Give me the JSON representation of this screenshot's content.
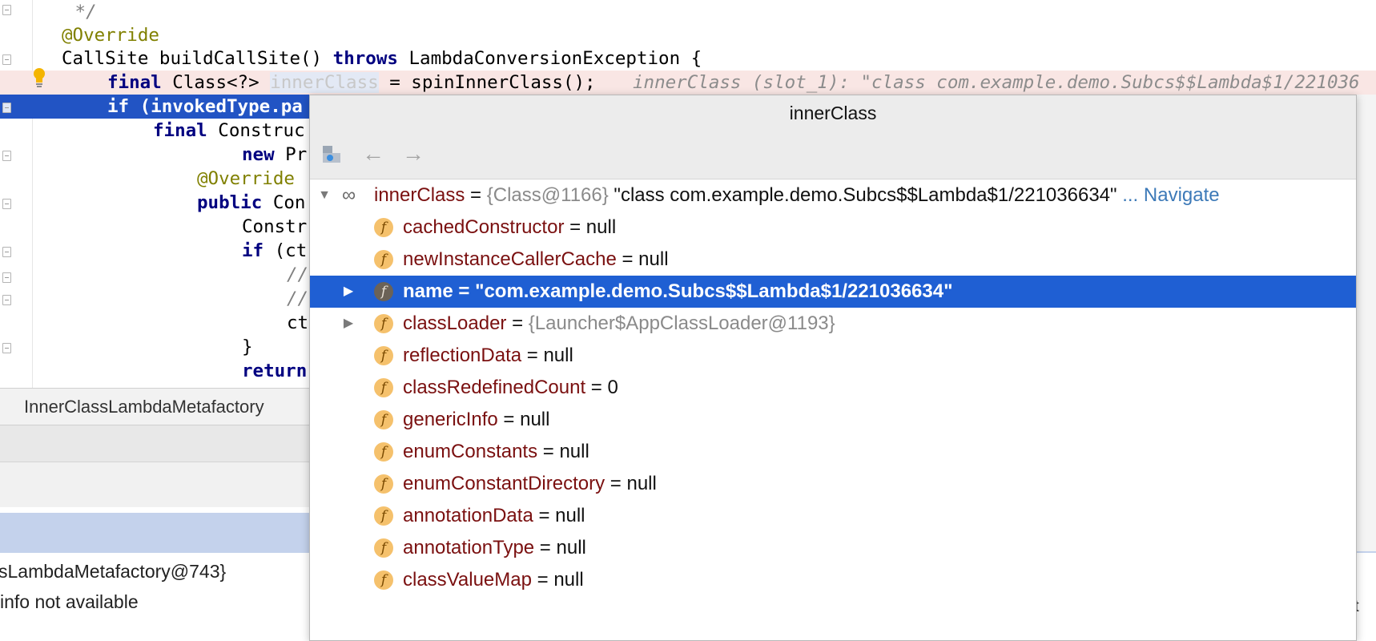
{
  "editor": {
    "lines": [
      {
        "text": " */"
      },
      {
        "annotation": "@Override"
      },
      {
        "text": "CallSite buildCallSite() ",
        "kw": "throws",
        "rest": " LambdaConversionException {"
      },
      {
        "kw": "final",
        "text": " Class<?> ",
        "var": "innerClass",
        "rest": " = spinInnerClass();",
        "inline": "innerClass (slot_1): \"class com.example.demo.Subcs$$Lambda$1/221036"
      },
      {
        "kw": "if",
        "text": " (invokedType.pa"
      },
      {
        "kw": "final",
        "text": " Construc"
      },
      {
        "kw": "new",
        "text": " Pr"
      },
      {
        "annotation": "@Override"
      },
      {
        "kw": "public",
        "text": " Con"
      },
      {
        "text": "Constr"
      },
      {
        "kw": "if",
        "text": " (ct"
      },
      {
        "comment": "//"
      },
      {
        "comment": "//"
      },
      {
        "text": "ct"
      },
      {
        "text": "}"
      },
      {
        "kw": "return"
      }
    ]
  },
  "breadcrumb": {
    "label": "InnerClassLambdaMetafactory"
  },
  "variables_panel": {
    "row1": "sLambdaMetafactory@743}",
    "row2": "info not available",
    "right_fragment": "nt"
  },
  "popup": {
    "title": "innerClass",
    "toolbar": {
      "browse_icon": "object-browse-icon",
      "back_icon": "arrow-left-icon",
      "forward_icon": "arrow-right-icon"
    },
    "root": {
      "name": "innerClass",
      "eq": " = ",
      "ref": "{Class@1166}",
      "value": " \"class com.example.demo.Subcs$$Lambda$1/221036634\"",
      "navigate": "... Navigate"
    },
    "fields": [
      {
        "name": "cachedConstructor",
        "value": "null"
      },
      {
        "name": "newInstanceCallerCache",
        "value": "null"
      },
      {
        "name": "name",
        "value": "\"com.example.demo.Subcs$$Lambda$1/221036634\"",
        "selected": true,
        "expandable": true
      },
      {
        "name": "classLoader",
        "value": "{Launcher$AppClassLoader@1193}",
        "expandable": true,
        "ref": true
      },
      {
        "name": "reflectionData",
        "value": "null"
      },
      {
        "name": "classRedefinedCount",
        "value": "0"
      },
      {
        "name": "genericInfo",
        "value": "null"
      },
      {
        "name": "enumConstants",
        "value": "null"
      },
      {
        "name": "enumConstantDirectory",
        "value": "null"
      },
      {
        "name": "annotationData",
        "value": "null"
      },
      {
        "name": "annotationType",
        "value": "null"
      },
      {
        "name": "classValueMap",
        "value": "null"
      }
    ],
    "field_icon_letter": "f"
  },
  "colors": {
    "selection": "#1f5fd3",
    "field_name": "#7a1010",
    "navigate_link": "#3d7ab8",
    "field_icon": "#f5c16c"
  }
}
